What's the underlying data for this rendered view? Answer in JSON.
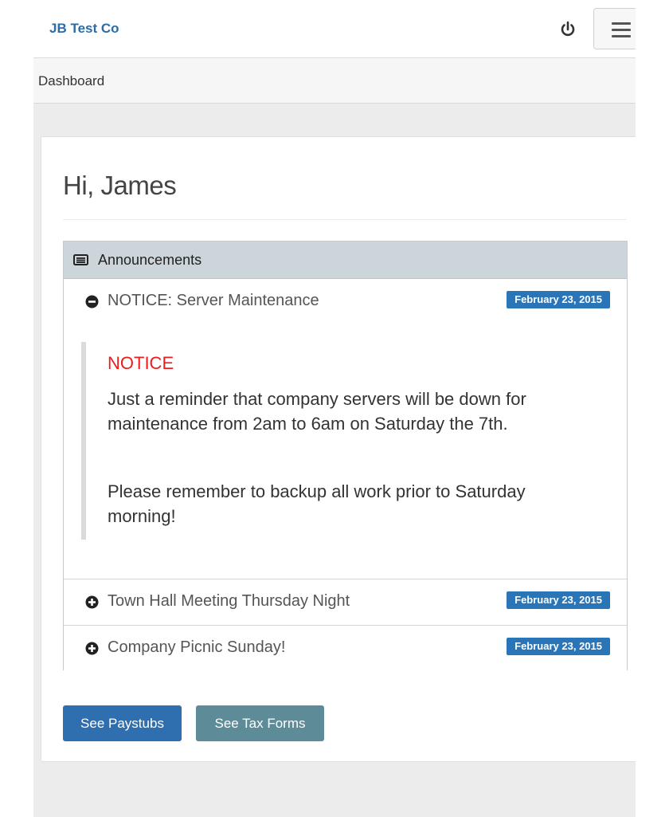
{
  "header": {
    "brand": "JB Test Co",
    "power_icon": "power-icon",
    "menu_icon": "hamburger-menu-icon"
  },
  "breadcrumb": {
    "current": "Dashboard"
  },
  "main": {
    "greeting": "Hi, James",
    "announcements": {
      "title": "Announcements",
      "icon": "list-alt-icon",
      "items": [
        {
          "title": "NOTICE: Server Maintenance",
          "date": "February 23, 2015",
          "expanded": true,
          "toggle_icon": "minus-circle-icon",
          "body": {
            "heading": "NOTICE",
            "paragraphs": [
              "Just a reminder that company servers will be down for maintenance from 2am to 6am on Saturday the 7th.",
              "Please remember to backup all work prior to Saturday morning!"
            ]
          }
        },
        {
          "title": "Town Hall Meeting Thursday Night",
          "date": "February 23, 2015",
          "expanded": false,
          "toggle_icon": "plus-circle-icon"
        },
        {
          "title": "Company Picnic Sunday!",
          "date": "February 23, 2015",
          "expanded": false,
          "toggle_icon": "plus-circle-icon"
        }
      ]
    },
    "buttons": {
      "paystubs": "See Paystubs",
      "tax_forms": "See Tax Forms"
    }
  },
  "colors": {
    "brand": "#2e6da4",
    "badge": "#2a75b7",
    "notice_heading": "#ee1c1c",
    "primary_button": "#2f6fb0",
    "info_button": "#5d8b98",
    "panel_header": "#ccd5d9"
  }
}
